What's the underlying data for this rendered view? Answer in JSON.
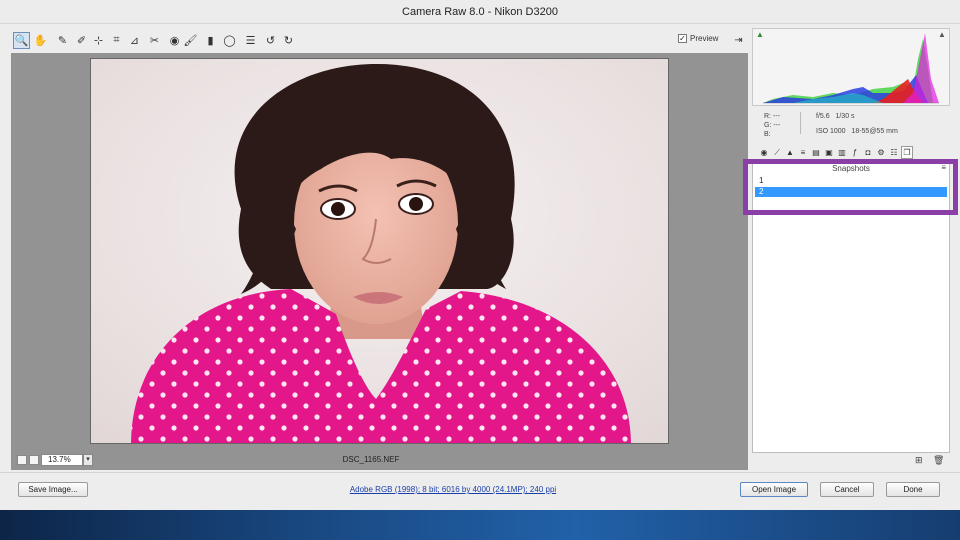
{
  "window": {
    "title": "Camera Raw 8.0  -  Nikon D3200"
  },
  "toolbar": {
    "tools": [
      {
        "name": "zoom-tool",
        "icon": "magnifier-icon",
        "glyph": "🔍"
      },
      {
        "name": "hand-tool",
        "icon": "hand-icon",
        "glyph": "✋"
      },
      {
        "name": "white-balance-tool",
        "icon": "eyedropper-icon",
        "glyph": "✎"
      },
      {
        "name": "color-sampler-tool",
        "icon": "color-sampler-icon",
        "glyph": "✐"
      },
      {
        "name": "targeted-adjustment-tool",
        "icon": "target-icon",
        "glyph": "⊹"
      },
      {
        "name": "crop-tool",
        "icon": "crop-icon",
        "glyph": "⌗"
      },
      {
        "name": "straighten-tool",
        "icon": "straighten-icon",
        "glyph": "⊿"
      },
      {
        "name": "spot-removal-tool",
        "icon": "spot-removal-icon",
        "glyph": "✂"
      },
      {
        "name": "red-eye-tool",
        "icon": "red-eye-icon",
        "glyph": "◉"
      },
      {
        "name": "adjustment-brush-tool",
        "icon": "brush-icon",
        "glyph": "🖌"
      },
      {
        "name": "graduated-filter-tool",
        "icon": "graduated-filter-icon",
        "glyph": "▮"
      },
      {
        "name": "radial-filter-tool",
        "icon": "radial-filter-icon",
        "glyph": "◯"
      },
      {
        "name": "preferences-tool",
        "icon": "list-icon",
        "glyph": "☰"
      },
      {
        "name": "rotate-ccw-tool",
        "icon": "rotate-left-icon",
        "glyph": "↺"
      },
      {
        "name": "rotate-cw-tool",
        "icon": "rotate-right-icon",
        "glyph": "↻"
      }
    ],
    "preview": {
      "label": "Preview",
      "checked": "✓"
    },
    "fullscreen_glyph": "⇥"
  },
  "preview_bar": {
    "zoom": "13.7%",
    "dropdown_glyph": "▾",
    "filename": "DSC_1165.NEF"
  },
  "histogram": {
    "clip_shadow": "▲",
    "clip_highlight": "▲"
  },
  "info": {
    "rgb_labels": [
      "R:",
      "G:",
      "B:"
    ],
    "rgb_values": [
      "---",
      "---",
      ""
    ],
    "aperture": "f/5.6",
    "shutter": "1/30 s",
    "iso": "ISO 1000",
    "lens": "18-55@55 mm"
  },
  "panel_tabs": [
    {
      "name": "tab-basic",
      "icon": "aperture-icon",
      "glyph": "◉"
    },
    {
      "name": "tab-tone-curve",
      "icon": "curve-icon",
      "glyph": "⟋"
    },
    {
      "name": "tab-detail",
      "icon": "triangle-icon",
      "glyph": "▲"
    },
    {
      "name": "tab-hsl",
      "icon": "stripes-icon",
      "glyph": "≡"
    },
    {
      "name": "tab-split-toning",
      "icon": "split-icon",
      "glyph": "▤"
    },
    {
      "name": "tab-lens",
      "icon": "lens-icon",
      "glyph": "▣"
    },
    {
      "name": "tab-effects",
      "icon": "effects-icon",
      "glyph": "▥"
    },
    {
      "name": "tab-camera-calibration",
      "icon": "fx-icon",
      "glyph": "ƒ"
    },
    {
      "name": "tab-calibration",
      "icon": "camera-icon",
      "glyph": "◘"
    },
    {
      "name": "tab-presets",
      "icon": "presets-icon",
      "glyph": "⚙"
    },
    {
      "name": "tab-settings",
      "icon": "sliders-icon",
      "glyph": "☷"
    },
    {
      "name": "tab-snapshots",
      "icon": "snapshots-icon",
      "glyph": "❐"
    }
  ],
  "snapshots": {
    "header": "Snapshots",
    "menu_glyph": "≡",
    "items": [
      {
        "label": "1"
      },
      {
        "label": "2"
      }
    ],
    "footer": {
      "new_glyph": "⊞",
      "delete_glyph": "🗑"
    }
  },
  "bottom": {
    "save_label": "Save Image...",
    "workflow_link": "Adobe RGB (1998); 8 bit; 6016 by 4000 (24.1MP); 240 ppi",
    "open_label": "Open Image",
    "cancel_label": "Cancel",
    "done_label": "Done"
  }
}
